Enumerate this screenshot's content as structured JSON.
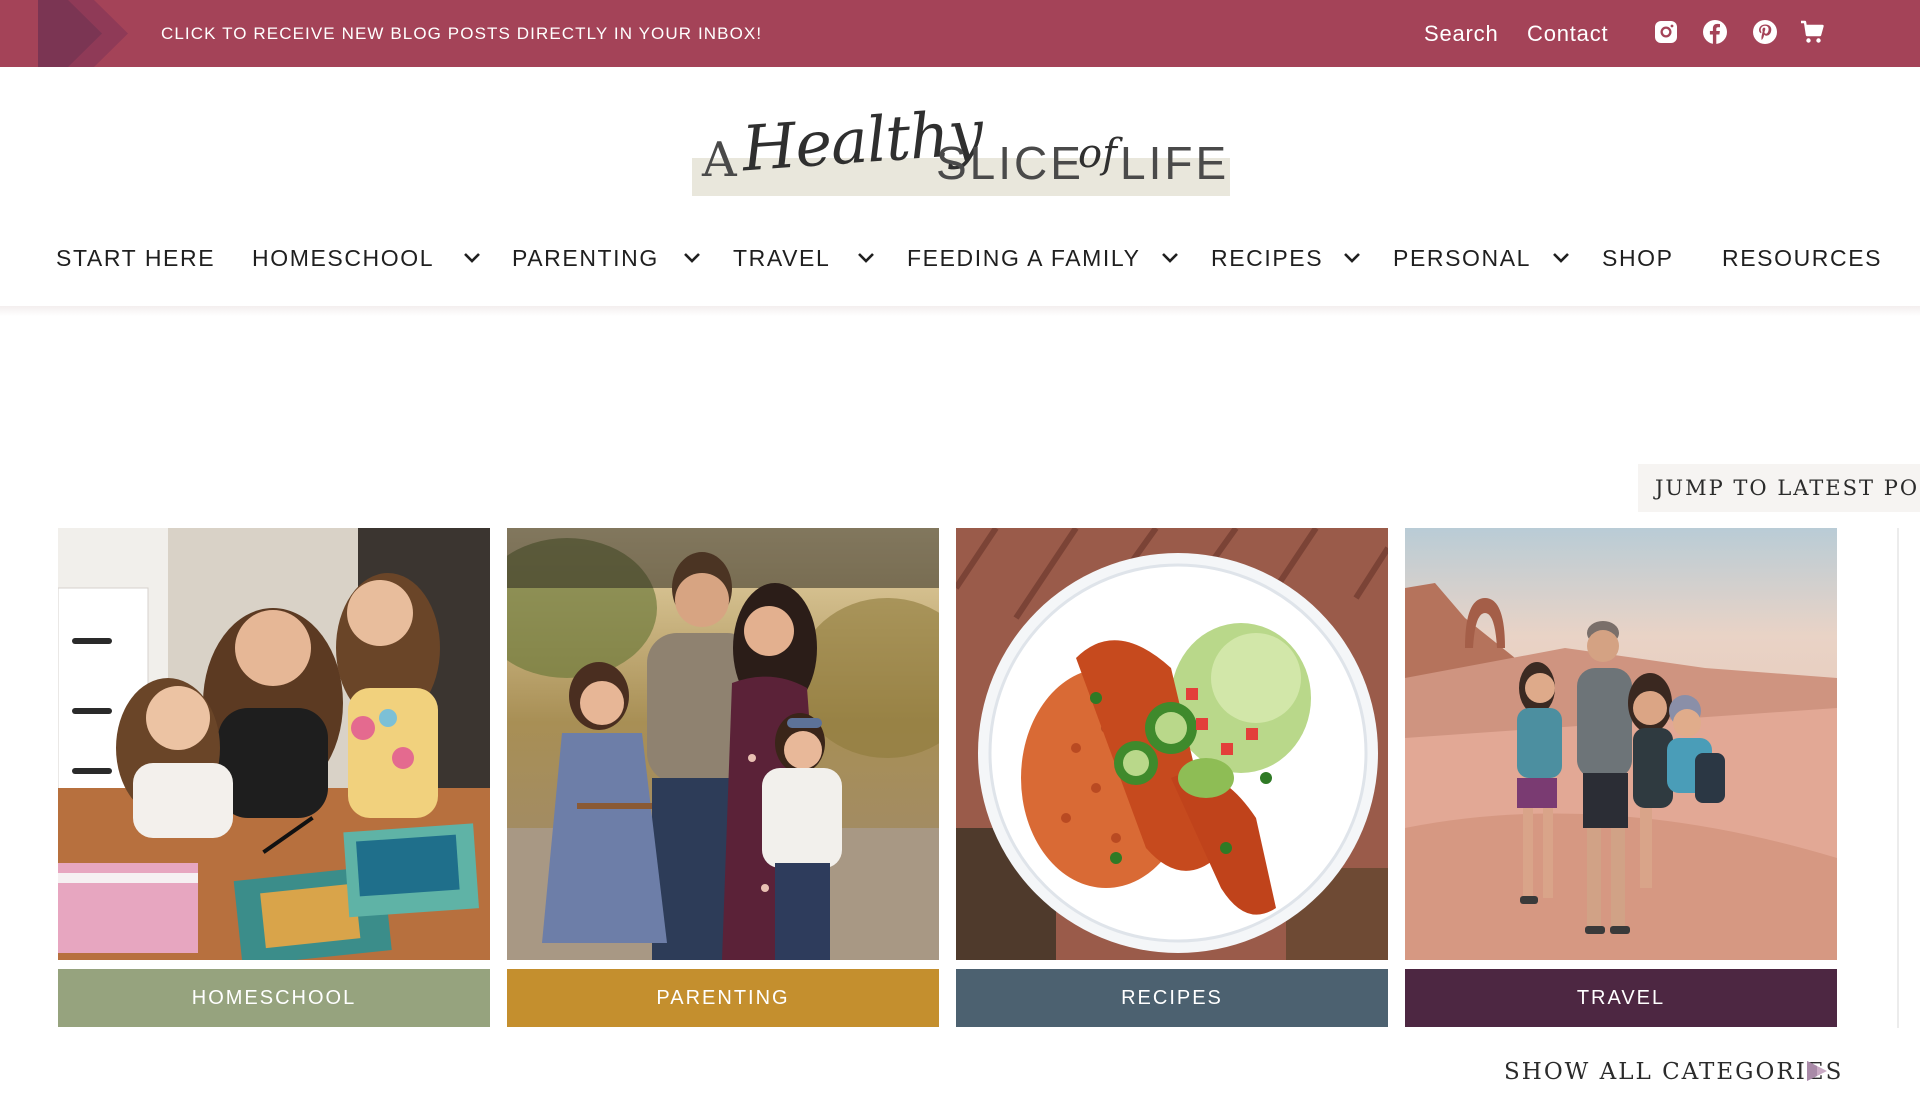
{
  "topbar": {
    "promo_text": "CLICK TO RECEIVE NEW BLOG POSTS DIRECTLY IN YOUR INBOX!",
    "search_label": "Search",
    "contact_label": "Contact",
    "social_icons": [
      "instagram-icon",
      "facebook-icon",
      "pinterest-icon",
      "cart-icon"
    ],
    "background_color": "#a44358"
  },
  "logo": {
    "word_a": "A",
    "word_healthy": "Healthy",
    "word_slice": "SLICE",
    "word_of": "of",
    "word_life": "LIFE"
  },
  "nav": {
    "items": [
      {
        "label": "START HERE",
        "has_dropdown": false
      },
      {
        "label": "HOMESCHOOL",
        "has_dropdown": true
      },
      {
        "label": "PARENTING",
        "has_dropdown": true
      },
      {
        "label": "TRAVEL",
        "has_dropdown": true
      },
      {
        "label": "FEEDING A FAMILY",
        "has_dropdown": true
      },
      {
        "label": "RECIPES",
        "has_dropdown": true
      },
      {
        "label": "PERSONAL",
        "has_dropdown": true
      },
      {
        "label": "SHOP",
        "has_dropdown": false
      },
      {
        "label": "RESOURCES",
        "has_dropdown": false
      }
    ]
  },
  "jump_tab": {
    "label": "JUMP TO LATEST POST"
  },
  "categories": [
    {
      "label": "HOMESCHOOL",
      "color": "#96a37e"
    },
    {
      "label": "PARENTING",
      "color": "#c48f2e"
    },
    {
      "label": "RECIPES",
      "color": "#4c6170"
    },
    {
      "label": "TRAVEL",
      "color": "#4d2742"
    }
  ],
  "show_all": {
    "label": "SHOW ALL CATEGORIES"
  }
}
